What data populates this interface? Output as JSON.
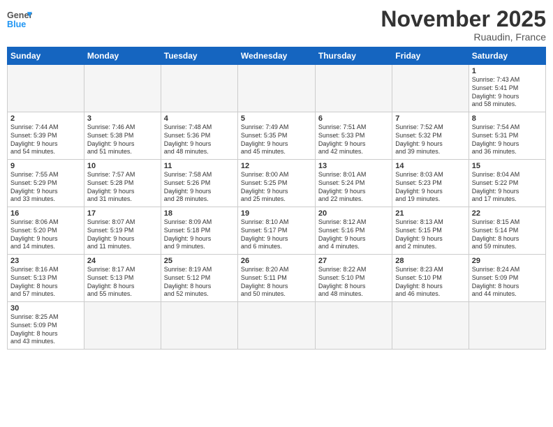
{
  "header": {
    "logo_general": "General",
    "logo_blue": "Blue",
    "title": "November 2025",
    "subtitle": "Ruaudin, France"
  },
  "weekdays": [
    "Sunday",
    "Monday",
    "Tuesday",
    "Wednesday",
    "Thursday",
    "Friday",
    "Saturday"
  ],
  "weeks": [
    {
      "days": [
        {
          "num": "",
          "info": ""
        },
        {
          "num": "",
          "info": ""
        },
        {
          "num": "",
          "info": ""
        },
        {
          "num": "",
          "info": ""
        },
        {
          "num": "",
          "info": ""
        },
        {
          "num": "",
          "info": ""
        },
        {
          "num": "1",
          "info": "Sunrise: 7:43 AM\nSunset: 5:41 PM\nDaylight: 9 hours\nand 58 minutes."
        }
      ]
    },
    {
      "days": [
        {
          "num": "2",
          "info": "Sunrise: 7:44 AM\nSunset: 5:39 PM\nDaylight: 9 hours\nand 54 minutes."
        },
        {
          "num": "3",
          "info": "Sunrise: 7:46 AM\nSunset: 5:38 PM\nDaylight: 9 hours\nand 51 minutes."
        },
        {
          "num": "4",
          "info": "Sunrise: 7:48 AM\nSunset: 5:36 PM\nDaylight: 9 hours\nand 48 minutes."
        },
        {
          "num": "5",
          "info": "Sunrise: 7:49 AM\nSunset: 5:35 PM\nDaylight: 9 hours\nand 45 minutes."
        },
        {
          "num": "6",
          "info": "Sunrise: 7:51 AM\nSunset: 5:33 PM\nDaylight: 9 hours\nand 42 minutes."
        },
        {
          "num": "7",
          "info": "Sunrise: 7:52 AM\nSunset: 5:32 PM\nDaylight: 9 hours\nand 39 minutes."
        },
        {
          "num": "8",
          "info": "Sunrise: 7:54 AM\nSunset: 5:31 PM\nDaylight: 9 hours\nand 36 minutes."
        }
      ]
    },
    {
      "days": [
        {
          "num": "9",
          "info": "Sunrise: 7:55 AM\nSunset: 5:29 PM\nDaylight: 9 hours\nand 33 minutes."
        },
        {
          "num": "10",
          "info": "Sunrise: 7:57 AM\nSunset: 5:28 PM\nDaylight: 9 hours\nand 31 minutes."
        },
        {
          "num": "11",
          "info": "Sunrise: 7:58 AM\nSunset: 5:26 PM\nDaylight: 9 hours\nand 28 minutes."
        },
        {
          "num": "12",
          "info": "Sunrise: 8:00 AM\nSunset: 5:25 PM\nDaylight: 9 hours\nand 25 minutes."
        },
        {
          "num": "13",
          "info": "Sunrise: 8:01 AM\nSunset: 5:24 PM\nDaylight: 9 hours\nand 22 minutes."
        },
        {
          "num": "14",
          "info": "Sunrise: 8:03 AM\nSunset: 5:23 PM\nDaylight: 9 hours\nand 19 minutes."
        },
        {
          "num": "15",
          "info": "Sunrise: 8:04 AM\nSunset: 5:22 PM\nDaylight: 9 hours\nand 17 minutes."
        }
      ]
    },
    {
      "days": [
        {
          "num": "16",
          "info": "Sunrise: 8:06 AM\nSunset: 5:20 PM\nDaylight: 9 hours\nand 14 minutes."
        },
        {
          "num": "17",
          "info": "Sunrise: 8:07 AM\nSunset: 5:19 PM\nDaylight: 9 hours\nand 11 minutes."
        },
        {
          "num": "18",
          "info": "Sunrise: 8:09 AM\nSunset: 5:18 PM\nDaylight: 9 hours\nand 9 minutes."
        },
        {
          "num": "19",
          "info": "Sunrise: 8:10 AM\nSunset: 5:17 PM\nDaylight: 9 hours\nand 6 minutes."
        },
        {
          "num": "20",
          "info": "Sunrise: 8:12 AM\nSunset: 5:16 PM\nDaylight: 9 hours\nand 4 minutes."
        },
        {
          "num": "21",
          "info": "Sunrise: 8:13 AM\nSunset: 5:15 PM\nDaylight: 9 hours\nand 2 minutes."
        },
        {
          "num": "22",
          "info": "Sunrise: 8:15 AM\nSunset: 5:14 PM\nDaylight: 8 hours\nand 59 minutes."
        }
      ]
    },
    {
      "days": [
        {
          "num": "23",
          "info": "Sunrise: 8:16 AM\nSunset: 5:13 PM\nDaylight: 8 hours\nand 57 minutes."
        },
        {
          "num": "24",
          "info": "Sunrise: 8:17 AM\nSunset: 5:13 PM\nDaylight: 8 hours\nand 55 minutes."
        },
        {
          "num": "25",
          "info": "Sunrise: 8:19 AM\nSunset: 5:12 PM\nDaylight: 8 hours\nand 52 minutes."
        },
        {
          "num": "26",
          "info": "Sunrise: 8:20 AM\nSunset: 5:11 PM\nDaylight: 8 hours\nand 50 minutes."
        },
        {
          "num": "27",
          "info": "Sunrise: 8:22 AM\nSunset: 5:10 PM\nDaylight: 8 hours\nand 48 minutes."
        },
        {
          "num": "28",
          "info": "Sunrise: 8:23 AM\nSunset: 5:10 PM\nDaylight: 8 hours\nand 46 minutes."
        },
        {
          "num": "29",
          "info": "Sunrise: 8:24 AM\nSunset: 5:09 PM\nDaylight: 8 hours\nand 44 minutes."
        }
      ]
    },
    {
      "days": [
        {
          "num": "30",
          "info": "Sunrise: 8:25 AM\nSunset: 5:09 PM\nDaylight: 8 hours\nand 43 minutes."
        },
        {
          "num": "",
          "info": ""
        },
        {
          "num": "",
          "info": ""
        },
        {
          "num": "",
          "info": ""
        },
        {
          "num": "",
          "info": ""
        },
        {
          "num": "",
          "info": ""
        },
        {
          "num": "",
          "info": ""
        }
      ]
    }
  ]
}
